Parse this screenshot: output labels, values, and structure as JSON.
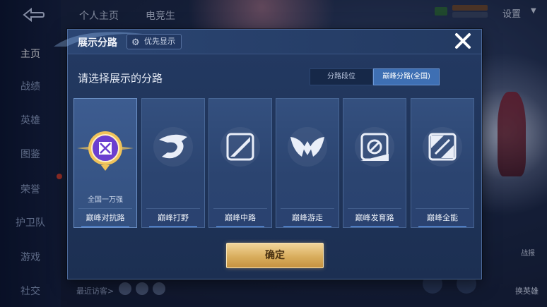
{
  "sidenav": {
    "items": [
      {
        "label": "主页",
        "active": true
      },
      {
        "label": "战绩",
        "active": false
      },
      {
        "label": "英雄",
        "active": false
      },
      {
        "label": "图鉴",
        "active": false
      },
      {
        "label": "荣誉",
        "active": false
      },
      {
        "label": "护卫队",
        "active": false
      },
      {
        "label": "游戏",
        "active": false
      },
      {
        "label": "社交",
        "active": false
      }
    ]
  },
  "topbar": {
    "tabs": [
      "个人主页",
      "电竞生"
    ],
    "settings_label": "设置"
  },
  "bottom": {
    "recent_label": "最近访客>",
    "change_hero_label": "换英雄",
    "live_label": "战报"
  },
  "modal": {
    "title": "展示分路",
    "priority_label": "优先显示",
    "prompt": "请选择展示的分路",
    "segments": [
      {
        "label": "分路段位",
        "active": false
      },
      {
        "label": "巅峰分路(全国)",
        "active": true
      }
    ],
    "cards": [
      {
        "name": "巅峰对抗路",
        "subtitle": "全国一万强",
        "icon": "clash-lane-gold-badge-icon",
        "selected": true
      },
      {
        "name": "巅峰打野",
        "subtitle": "",
        "icon": "jungle-dragon-icon",
        "selected": false
      },
      {
        "name": "巅峰中路",
        "subtitle": "",
        "icon": "mid-lane-slash-icon",
        "selected": false
      },
      {
        "name": "巅峰游走",
        "subtitle": "",
        "icon": "roam-wings-icon",
        "selected": false
      },
      {
        "name": "巅峰发育路",
        "subtitle": "",
        "icon": "farm-lane-icon",
        "selected": false
      },
      {
        "name": "巅峰全能",
        "subtitle": "",
        "icon": "all-round-icon",
        "selected": false
      }
    ],
    "confirm_label": "确定"
  },
  "colors": {
    "confirm_gold": "#d9ae5e",
    "active_segment": "#3e6fb3",
    "badge_purple": "#6a3fd0",
    "badge_gold": "#f0c35a"
  }
}
